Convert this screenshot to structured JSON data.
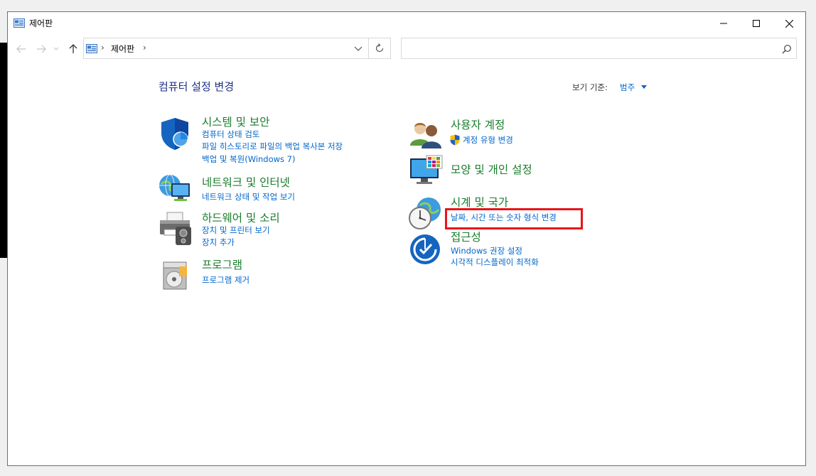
{
  "window": {
    "title": "제어판",
    "controls": {
      "minimize": "minimize",
      "maximize": "maximize",
      "close": "close"
    }
  },
  "nav": {
    "address_crumb": "제어판",
    "separator": "›",
    "search_placeholder": ""
  },
  "content": {
    "heading": "컴퓨터 설정 변경",
    "view_by_label": "보기 기준:",
    "view_by_value": "범주"
  },
  "categories": {
    "system_security": {
      "title": "시스템 및 보안",
      "links": [
        "컴퓨터 상태 검토",
        "파일 히스토리로 파일의 백업 복사본 저장",
        "백업 및 복원(Windows 7)"
      ]
    },
    "network": {
      "title": "네트워크 및 인터넷",
      "links": [
        "네트워크 상태 및 작업 보기"
      ]
    },
    "hardware": {
      "title": "하드웨어 및 소리",
      "links": [
        "장치 및 프린터 보기",
        "장치 추가"
      ]
    },
    "programs": {
      "title": "프로그램",
      "links": [
        "프로그램 제거"
      ]
    },
    "user_accounts": {
      "title": "사용자 계정",
      "links": [
        "계정 유형 변경"
      ]
    },
    "appearance": {
      "title": "모양 및 개인 설정",
      "links": []
    },
    "clock_region": {
      "title": "시계 및 국가",
      "links": [
        "날짜, 시간 또는 숫자 형식 변경"
      ]
    },
    "accessibility": {
      "title": "접근성",
      "links": [
        "Windows 권장 설정",
        "시각적 디스플레이 최적화"
      ]
    }
  },
  "colors": {
    "category_title": "#1a7d2c",
    "link": "#0066cc",
    "heading": "#1e3287",
    "highlight": "#e8141b"
  },
  "icons": {
    "app": "control-panel-icon",
    "back": "back-arrow-icon",
    "forward": "forward-arrow-icon",
    "recent": "chevron-down-icon",
    "up": "up-arrow-icon",
    "refresh": "refresh-icon",
    "search": "search-icon"
  }
}
